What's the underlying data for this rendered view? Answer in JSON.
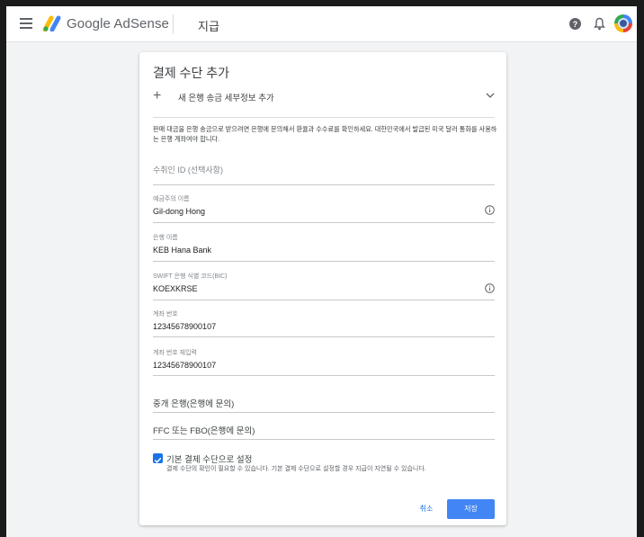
{
  "header": {
    "app_name": "Google AdSense",
    "section": "지급"
  },
  "card": {
    "title": "결제 수단 추가",
    "add_bank_label": "새 은행 송금 세부정보 추가",
    "description": "판매 대금을 은행 송금으로 받으려면 은행에 문의해서 환율과 수수료를 확인하세요. 대한민국에서 발급된 미국 달러 통화를 사용하는 은행 계좌여야 합니다.",
    "fields": {
      "payee_id_placeholder": "수취인 ID (선택사항)",
      "holder_label": "예금주의 이름",
      "holder_value": "Gil-dong Hong",
      "bank_label": "은행 이름",
      "bank_value": "KEB Hana Bank",
      "swift_label": "SWIFT 은행 식별 코드(BIC)",
      "swift_value": "KOEXKRSE",
      "account_label": "계좌 번호",
      "account_value": "12345678900107",
      "account_confirm_label": "계좌 번호 재입력",
      "account_confirm_value": "12345678900107",
      "intermediary_label": "중개 은행(은행에 문의)",
      "ffc_label": "FFC 또는 FBO(은행에 문의)"
    },
    "default_checkbox": {
      "checked": true,
      "label": "기본 결제 수단으로 설정",
      "sub": "결제 수단의 확인이 필요할 수 있습니다. 기본 결제 수단으로 설정할 경우 지급이 지연될 수 있습니다."
    },
    "buttons": {
      "cancel": "취소",
      "save": "저장"
    }
  },
  "colors": {
    "accent": "#4285f4",
    "link": "#1a73e8"
  }
}
